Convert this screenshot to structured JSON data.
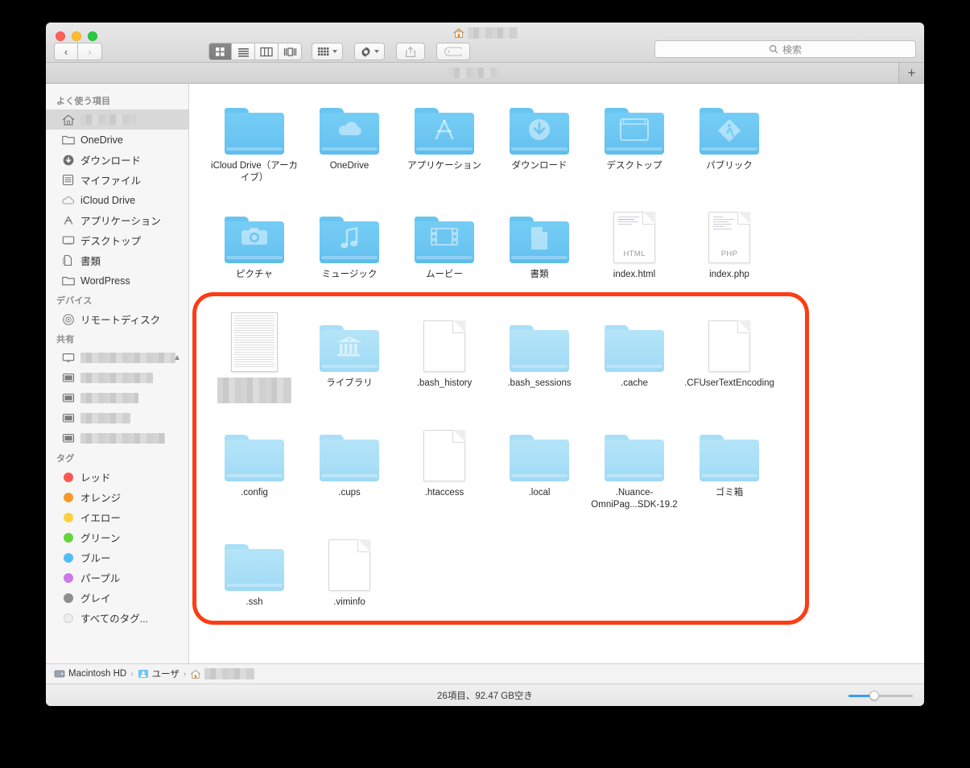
{
  "window": {
    "title_redacted": true,
    "home_icon": "house-icon"
  },
  "toolbar": {
    "back_label": "‹",
    "forward_label": "›",
    "view_icon": "grid-view-icon",
    "view_list_icon": "list-view-icon",
    "view_column_icon": "column-view-icon",
    "view_coverflow_icon": "coverflow-view-icon",
    "arrange_icon": "arrange-icon",
    "action_icon": "gear-icon",
    "share_icon": "share-icon",
    "tag_icon": "tag-icon"
  },
  "search": {
    "placeholder": "検索",
    "icon": "search-icon"
  },
  "tabbar": {
    "new_tab_label": "+"
  },
  "sidebar": {
    "sections": [
      {
        "title": "よく使う項目",
        "items": [
          {
            "label": "",
            "icon": "house-icon",
            "redacted": true,
            "selected": true
          },
          {
            "label": "OneDrive",
            "icon": "folder-icon"
          },
          {
            "label": "ダウンロード",
            "icon": "download-icon"
          },
          {
            "label": "マイファイル",
            "icon": "allmyfiles-icon"
          },
          {
            "label": "iCloud Drive",
            "icon": "cloud-icon"
          },
          {
            "label": "アプリケーション",
            "icon": "applications-icon"
          },
          {
            "label": "デスクトップ",
            "icon": "desktop-icon"
          },
          {
            "label": "書類",
            "icon": "documents-icon"
          },
          {
            "label": "WordPress",
            "icon": "folder-icon"
          }
        ]
      },
      {
        "title": "デバイス",
        "items": [
          {
            "label": "リモートディスク",
            "icon": "disc-icon"
          }
        ]
      },
      {
        "title": "共有",
        "items": [
          {
            "label": "",
            "icon": "display-icon",
            "redacted": true,
            "redact_width": 118,
            "eject": true
          },
          {
            "label": "",
            "icon": "computer-icon",
            "redacted": true,
            "redact_width": 90
          },
          {
            "label": "",
            "icon": "computer-icon",
            "redacted": true,
            "redact_width": 72
          },
          {
            "label": "",
            "icon": "computer-icon",
            "redacted": true,
            "redact_width": 62
          },
          {
            "label": "",
            "icon": "computer-icon",
            "redacted": true,
            "redact_width": 105
          }
        ]
      },
      {
        "title": "タグ",
        "items": [
          {
            "label": "レッド",
            "icon": "tag-dot-icon",
            "color": "#fc5753"
          },
          {
            "label": "オレンジ",
            "icon": "tag-dot-icon",
            "color": "#f7992a"
          },
          {
            "label": "イエロー",
            "icon": "tag-dot-icon",
            "color": "#fbd13d"
          },
          {
            "label": "グリーン",
            "icon": "tag-dot-icon",
            "color": "#63d43c"
          },
          {
            "label": "ブルー",
            "icon": "tag-dot-icon",
            "color": "#52bdf5"
          },
          {
            "label": "パープル",
            "icon": "tag-dot-icon",
            "color": "#ca7ae6"
          },
          {
            "label": "グレイ",
            "icon": "tag-dot-icon",
            "color": "#8e8e8e"
          },
          {
            "label": "すべてのタグ...",
            "icon": "all-tags-icon",
            "color": "#e8e8e8"
          }
        ]
      }
    ]
  },
  "main": {
    "items": [
      {
        "name": "iCloud Drive（アーカイブ）",
        "type": "folder",
        "glyph": "none",
        "row": 1
      },
      {
        "name": "OneDrive",
        "type": "folder",
        "glyph": "cloud",
        "row": 1
      },
      {
        "name": "アプリケーション",
        "type": "folder",
        "glyph": "appstore",
        "row": 1
      },
      {
        "name": "ダウンロード",
        "type": "folder",
        "glyph": "download",
        "row": 1
      },
      {
        "name": "デスクトップ",
        "type": "folder",
        "glyph": "window",
        "row": 1
      },
      {
        "name": "パブリック",
        "type": "folder",
        "glyph": "walker",
        "row": 1
      },
      {
        "name": "ピクチャ",
        "type": "folder",
        "glyph": "camera",
        "row": 2
      },
      {
        "name": "ミュージック",
        "type": "folder",
        "glyph": "note",
        "row": 2
      },
      {
        "name": "ムービー",
        "type": "folder",
        "glyph": "film",
        "row": 2
      },
      {
        "name": "書類",
        "type": "folder",
        "glyph": "doc",
        "row": 2
      },
      {
        "name": "index.html",
        "type": "document",
        "kind": "HTML",
        "row": 2
      },
      {
        "name": "index.php",
        "type": "document",
        "kind": "PHP",
        "row": 2
      },
      {
        "name": "",
        "type": "thumbnail",
        "redacted": true,
        "row": 3
      },
      {
        "name": "ライブラリ",
        "type": "folder-pale",
        "glyph": "library",
        "row": 3
      },
      {
        "name": ".bash_history",
        "type": "document-plain",
        "row": 3
      },
      {
        "name": ".bash_sessions",
        "type": "folder-pale",
        "glyph": "none",
        "row": 3
      },
      {
        "name": ".cache",
        "type": "folder-pale",
        "glyph": "none",
        "row": 3
      },
      {
        "name": ".CFUserTextEncoding",
        "type": "document-plain",
        "row": 3
      },
      {
        "name": ".config",
        "type": "folder-pale",
        "glyph": "none",
        "row": 4
      },
      {
        "name": ".cups",
        "type": "folder-pale",
        "glyph": "none",
        "row": 4
      },
      {
        "name": ".htaccess",
        "type": "document-plain",
        "row": 4
      },
      {
        "name": ".local",
        "type": "folder-pale",
        "glyph": "none",
        "row": 4
      },
      {
        "name": ".Nuance-OmniPag...SDK-19.2",
        "type": "folder-pale",
        "glyph": "none",
        "row": 4
      },
      {
        "name": "ゴミ箱",
        "type": "folder-pale",
        "glyph": "none",
        "row": 4
      },
      {
        "name": ".ssh",
        "type": "folder-pale",
        "glyph": "none",
        "row": 5
      },
      {
        "name": ".viminfo",
        "type": "document-plain",
        "row": 5
      }
    ],
    "highlight": {
      "color": "#ff3b14",
      "shape": "rounded-rectangle"
    }
  },
  "pathbar": {
    "segments": [
      {
        "label": "Macintosh HD",
        "icon": "harddisk-icon"
      },
      {
        "label": "ユーザ",
        "icon": "users-folder-icon"
      },
      {
        "label": "",
        "icon": "house-icon",
        "redacted": true
      }
    ],
    "separator": "›"
  },
  "statusbar": {
    "text": "26項目、92.47 GB空き",
    "zoom_value": 40
  }
}
